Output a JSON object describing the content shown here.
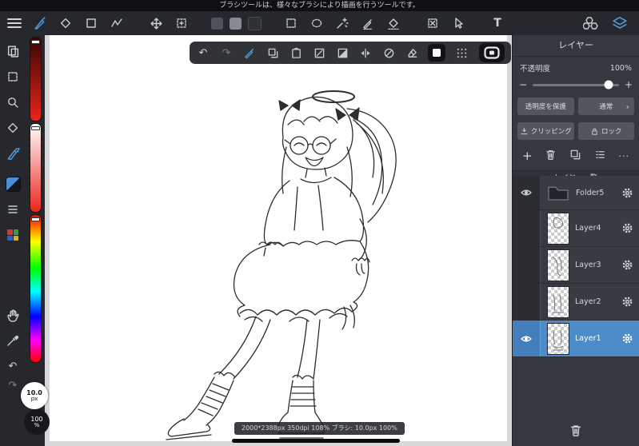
{
  "tooltip_bar": {
    "text": "ブラシツールは、様々なブラシにより描画を行うツールです。"
  },
  "glyphs": {
    "undo": "↶",
    "redo": "↷",
    "plus": "+",
    "minus": "−",
    "chevron_right": "›",
    "more": "···",
    "text_tool": "T"
  },
  "left_sidebar": {
    "brush_size": "10.0",
    "brush_size_unit": "px",
    "zoom_value": "100",
    "zoom_unit": "%"
  },
  "canvas": {
    "status_text": "2000*2388px 350dpi 108% ブラシ: 10.0px 100%"
  },
  "layers_panel": {
    "title": "レイヤー",
    "opacity_label": "不透明度",
    "opacity_value": "100%",
    "protect_alpha_label": "透明度を保護",
    "blend_mode_label": "通常",
    "clipping_label": "クリッピング",
    "lock_label": "ロック",
    "list_title": "レイヤー一覧",
    "layers": [
      {
        "name": "Folder5"
      },
      {
        "name": "Layer4"
      },
      {
        "name": "Layer3"
      },
      {
        "name": "Layer2"
      },
      {
        "name": "Layer1"
      }
    ]
  },
  "colors": {
    "accent": "#4a90d9",
    "selected_row": "#4d8bc9",
    "canvas_bg": "#d7d8da"
  }
}
